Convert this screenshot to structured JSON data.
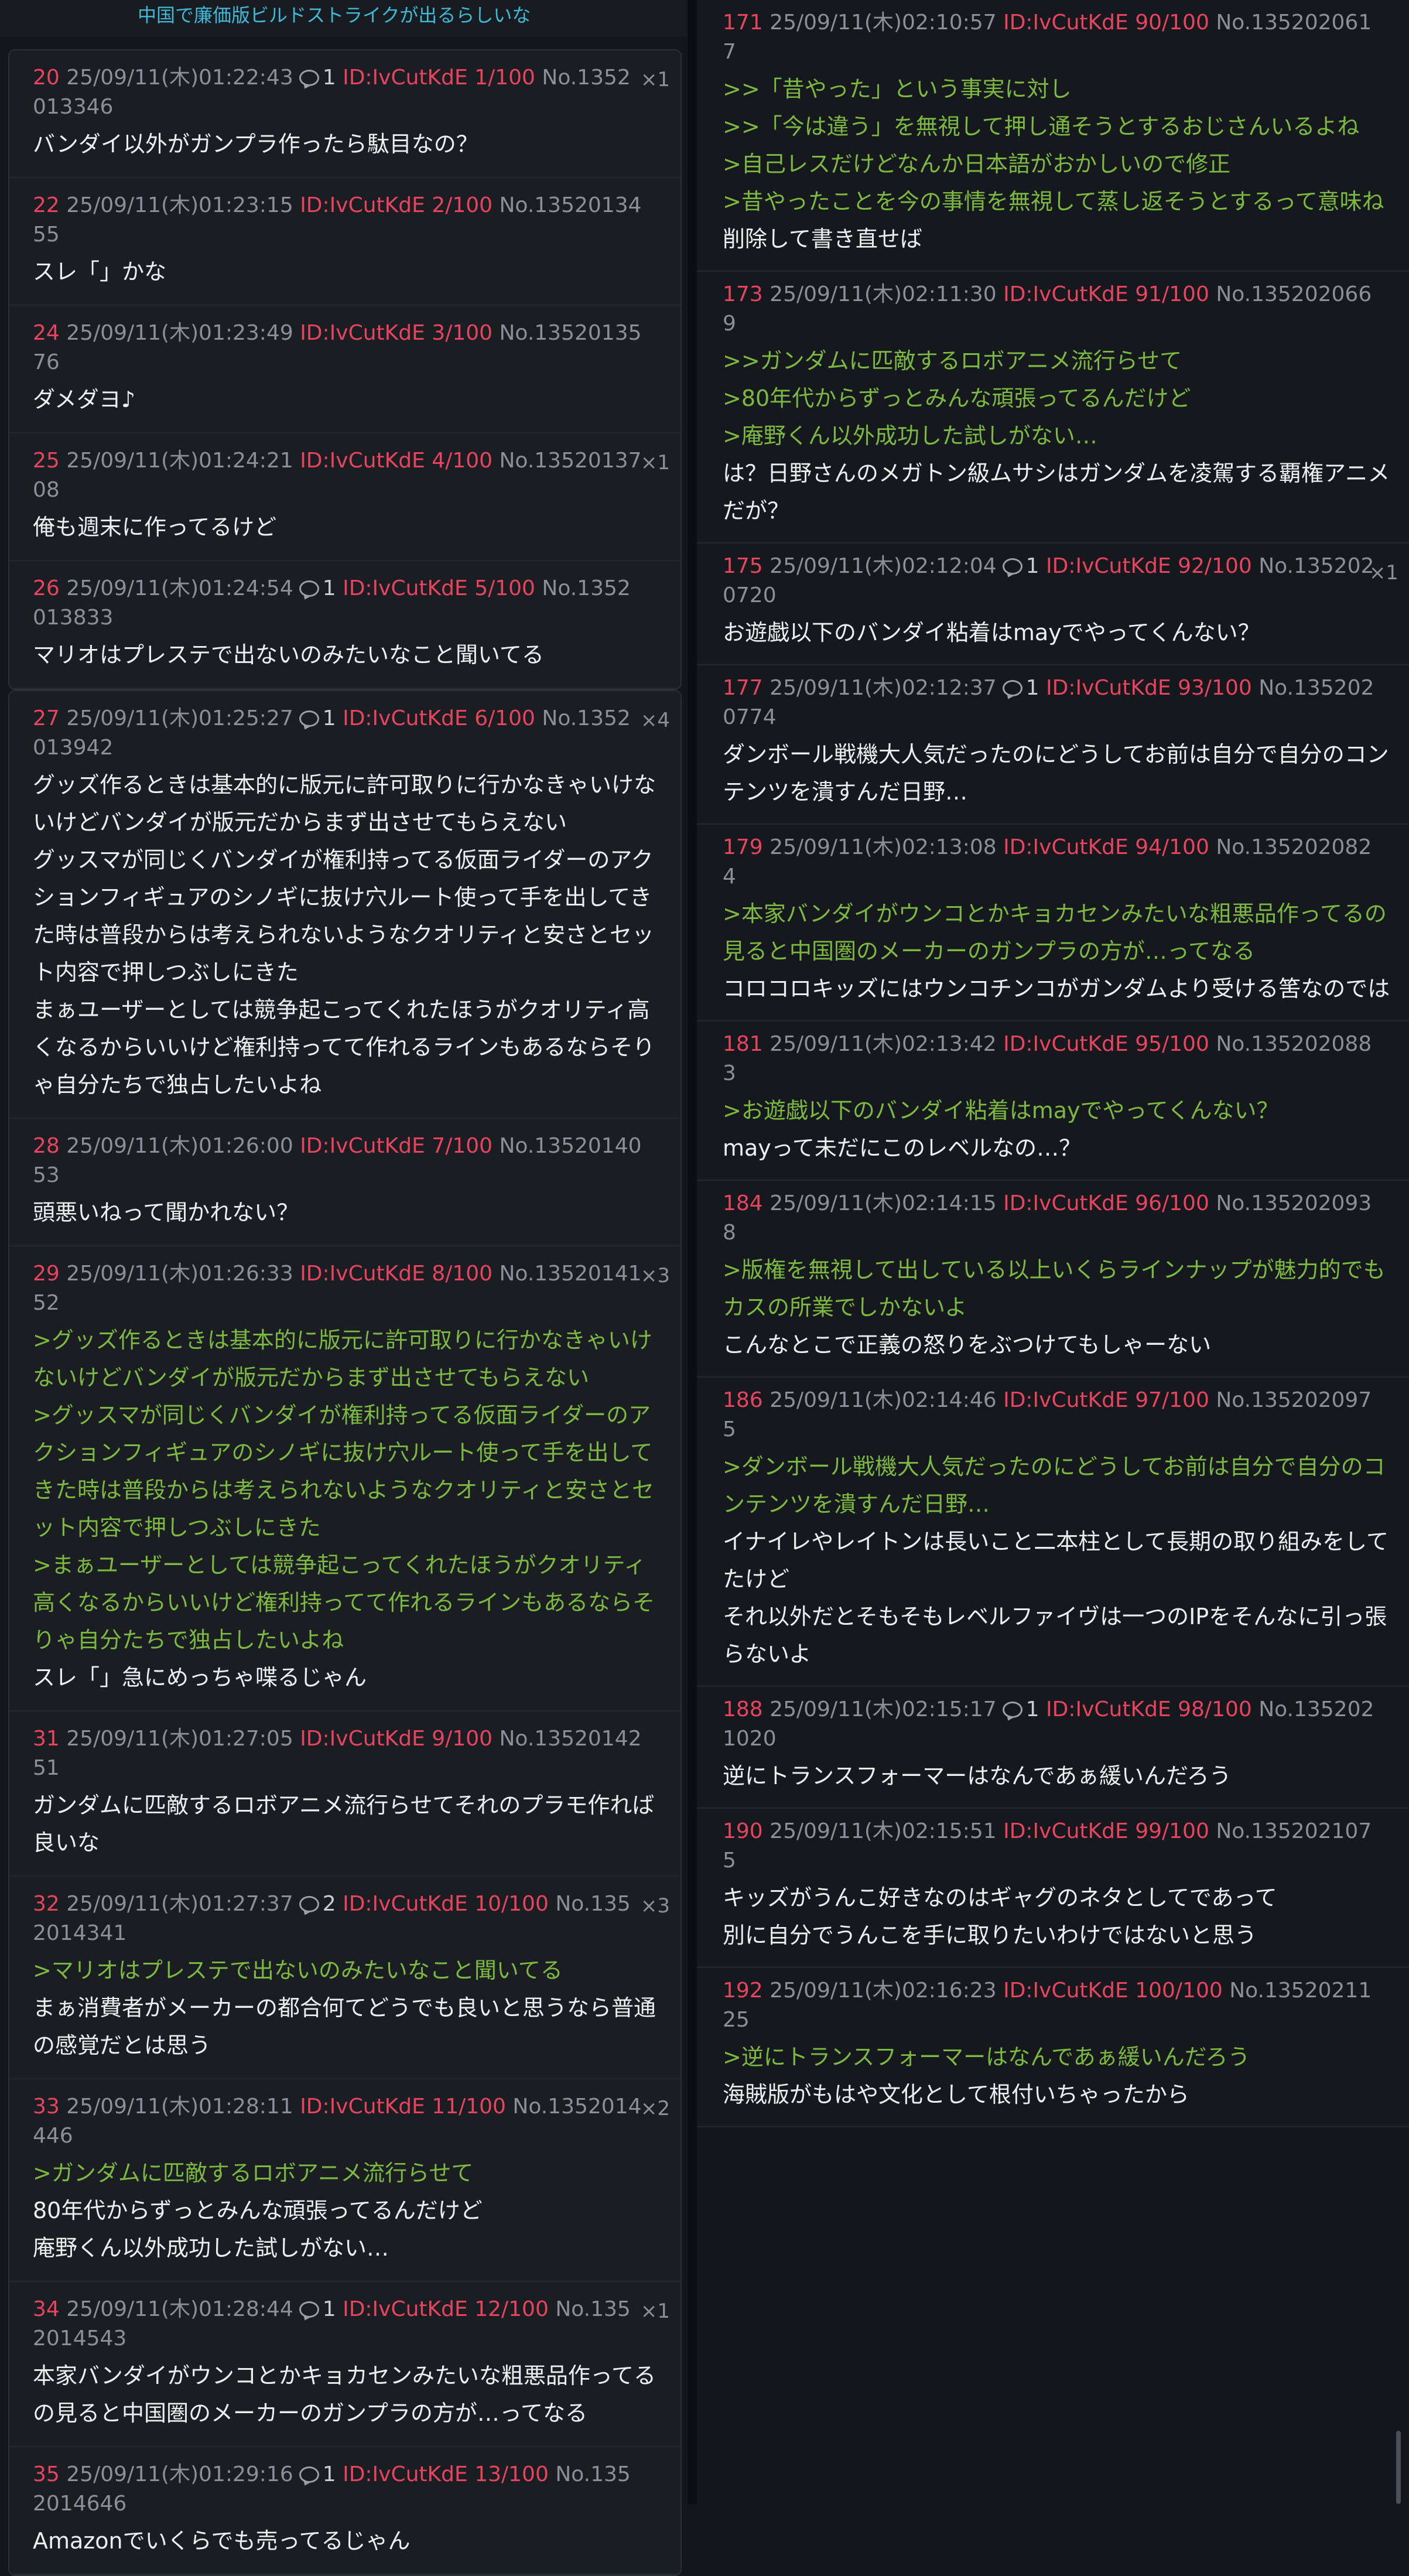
{
  "thread_title": "中国で廉価版ビルドストライクが出るらしいな",
  "left_posts": [
    {
      "num": "20",
      "date": "25/09/11(木)01:22:43",
      "replies": "1",
      "uid": "ID:IvCutKdE 1/100",
      "no": "No.1352013346",
      "x": "×1",
      "lines": [
        {
          "q": false,
          "t": "バンダイ以外がガンプラ作ったら駄目なの？"
        }
      ]
    },
    {
      "num": "22",
      "date": "25/09/11(木)01:23:15",
      "replies": "",
      "uid": "ID:IvCutKdE 2/100",
      "no": "No.1352013455",
      "x": "",
      "lines": [
        {
          "q": false,
          "t": "スレ「」かな"
        }
      ]
    },
    {
      "num": "24",
      "date": "25/09/11(木)01:23:49",
      "replies": "",
      "uid": "ID:IvCutKdE 3/100",
      "no": "No.1352013576",
      "x": "",
      "lines": [
        {
          "q": false,
          "t": "ダメダヨ♪"
        }
      ]
    },
    {
      "num": "25",
      "date": "25/09/11(木)01:24:21",
      "replies": "",
      "uid": "ID:IvCutKdE 4/100",
      "no": "No.1352013708",
      "x": "×1",
      "lines": [
        {
          "q": false,
          "t": "俺も週末に作ってるけど"
        }
      ]
    },
    {
      "num": "26",
      "date": "25/09/11(木)01:24:54",
      "replies": "1",
      "uid": "ID:IvCutKdE 5/100",
      "no": "No.1352013833",
      "x": "",
      "lines": [
        {
          "q": false,
          "t": "マリオはプレステで出ないのみたいなこと聞いてる"
        }
      ]
    },
    {
      "num": "27",
      "date": "25/09/11(木)01:25:27",
      "replies": "1",
      "uid": "ID:IvCutKdE 6/100",
      "no": "No.1352013942",
      "x": "×4",
      "lines": [
        {
          "q": false,
          "t": "グッズ作るときは基本的に版元に許可取りに行かなきゃいけないけどバンダイが版元だからまず出させてもらえない"
        },
        {
          "q": false,
          "t": "グッスマが同じくバンダイが権利持ってる仮面ライダーのアクションフィギュアのシノギに抜け穴ルート使って手を出してきた時は普段からは考えられないようなクオリティと安さとセット内容で押しつぶしにきた"
        },
        {
          "q": false,
          "t": "まぁユーザーとしては競争起こってくれたほうがクオリティ高くなるからいいけど権利持ってて作れるラインもあるならそりゃ自分たちで独占したいよね"
        }
      ]
    },
    {
      "num": "28",
      "date": "25/09/11(木)01:26:00",
      "replies": "",
      "uid": "ID:IvCutKdE 7/100",
      "no": "No.1352014053",
      "x": "",
      "lines": [
        {
          "q": false,
          "t": "頭悪いねって聞かれない？"
        }
      ]
    },
    {
      "num": "29",
      "date": "25/09/11(木)01:26:33",
      "replies": "",
      "uid": "ID:IvCutKdE 8/100",
      "no": "No.1352014152",
      "x": "×3",
      "lines": [
        {
          "q": true,
          "t": ">グッズ作るときは基本的に版元に許可取りに行かなきゃいけないけどバンダイが版元だからまず出させてもらえない"
        },
        {
          "q": true,
          "t": ">グッスマが同じくバンダイが権利持ってる仮面ライダーのアクションフィギュアのシノギに抜け穴ルート使って手を出してきた時は普段からは考えられないようなクオリティと安さとセット内容で押しつぶしにきた"
        },
        {
          "q": true,
          "t": ">まぁユーザーとしては競争起こってくれたほうがクオリティ高くなるからいいけど権利持ってて作れるラインもあるならそりゃ自分たちで独占したいよね"
        },
        {
          "q": false,
          "t": "スレ「」急にめっちゃ喋るじゃん"
        }
      ]
    },
    {
      "num": "31",
      "date": "25/09/11(木)01:27:05",
      "replies": "",
      "uid": "ID:IvCutKdE 9/100",
      "no": "No.1352014251",
      "x": "",
      "lines": [
        {
          "q": false,
          "t": "ガンダムに匹敵するロボアニメ流行らせてそれのプラモ作れば良いな"
        }
      ]
    },
    {
      "num": "32",
      "date": "25/09/11(木)01:27:37",
      "replies": "2",
      "uid": "ID:IvCutKdE 10/100",
      "no": "No.1352014341",
      "x": "×3",
      "lines": [
        {
          "q": true,
          "t": ">マリオはプレステで出ないのみたいなこと聞いてる"
        },
        {
          "q": false,
          "t": "まぁ消費者がメーカーの都合何てどうでも良いと思うなら普通の感覚だとは思う"
        }
      ]
    },
    {
      "num": "33",
      "date": "25/09/11(木)01:28:11",
      "replies": "",
      "uid": "ID:IvCutKdE 11/100",
      "no": "No.1352014446",
      "x": "×2",
      "lines": [
        {
          "q": true,
          "t": ">ガンダムに匹敵するロボアニメ流行らせて"
        },
        {
          "q": false,
          "t": "80年代からずっとみんな頑張ってるんだけど"
        },
        {
          "q": false,
          "t": "庵野くん以外成功した試しがない…"
        }
      ]
    },
    {
      "num": "34",
      "date": "25/09/11(木)01:28:44",
      "replies": "1",
      "uid": "ID:IvCutKdE 12/100",
      "no": "No.1352014543",
      "x": "×1",
      "lines": [
        {
          "q": false,
          "t": "本家バンダイがウンコとかキョカセンみたいな粗悪品作ってるの見ると中国圏のメーカーのガンプラの方が…ってなる"
        }
      ]
    },
    {
      "num": "35",
      "date": "25/09/11(木)01:29:16",
      "replies": "1",
      "uid": "ID:IvCutKdE 13/100",
      "no": "No.1352014646",
      "x": "",
      "lines": [
        {
          "q": false,
          "t": "Amazonでいくらでも売ってるじゃん"
        }
      ]
    }
  ],
  "right_posts": [
    {
      "num": "171",
      "date": "25/09/11(木)02:10:57",
      "replies": "",
      "uid": "ID:IvCutKdE 90/100",
      "no": "No.1352020617",
      "x": "",
      "lines": [
        {
          "q": true,
          "t": ">>「昔やった」という事実に対し"
        },
        {
          "q": true,
          "t": ">>「今は違う」を無視して押し通そうとするおじさんいるよね"
        },
        {
          "q": true,
          "t": ">自己レスだけどなんか日本語がおかしいので修正"
        },
        {
          "q": true,
          "t": ">昔やったことを今の事情を無視して蒸し返そうとするって意味ね"
        },
        {
          "q": false,
          "t": "削除して書き直せば"
        }
      ]
    },
    {
      "num": "173",
      "date": "25/09/11(木)02:11:30",
      "replies": "",
      "uid": "ID:IvCutKdE 91/100",
      "no": "No.1352020669",
      "x": "",
      "lines": [
        {
          "q": true,
          "t": ">>ガンダムに匹敵するロボアニメ流行らせて"
        },
        {
          "q": true,
          "t": ">80年代からずっとみんな頑張ってるんだけど"
        },
        {
          "q": true,
          "t": ">庵野くん以外成功した試しがない…"
        },
        {
          "q": false,
          "t": "は？日野さんのメガトン級ムサシはガンダムを凌駕する覇権アニメだが？"
        }
      ]
    },
    {
      "num": "175",
      "date": "25/09/11(木)02:12:04",
      "replies": "1",
      "uid": "ID:IvCutKdE 92/100",
      "no": "No.1352020720",
      "x": "×1",
      "lines": [
        {
          "q": false,
          "t": "お遊戯以下のバンダイ粘着はmayでやってくんない？"
        }
      ]
    },
    {
      "num": "177",
      "date": "25/09/11(木)02:12:37",
      "replies": "1",
      "uid": "ID:IvCutKdE 93/100",
      "no": "No.1352020774",
      "x": "",
      "lines": [
        {
          "q": false,
          "t": "ダンボール戦機大人気だったのにどうしてお前は自分で自分のコンテンツを潰すんだ日野…"
        }
      ]
    },
    {
      "num": "179",
      "date": "25/09/11(木)02:13:08",
      "replies": "",
      "uid": "ID:IvCutKdE 94/100",
      "no": "No.1352020824",
      "x": "",
      "lines": [
        {
          "q": true,
          "t": ">本家バンダイがウンコとかキョカセンみたいな粗悪品作ってるの見ると中国圏のメーカーのガンプラの方が…ってなる"
        },
        {
          "q": false,
          "t": "コロコロキッズにはウンコチンコがガンダムより受ける筈なのでは"
        }
      ]
    },
    {
      "num": "181",
      "date": "25/09/11(木)02:13:42",
      "replies": "",
      "uid": "ID:IvCutKdE 95/100",
      "no": "No.1352020883",
      "x": "",
      "lines": [
        {
          "q": true,
          "t": ">お遊戯以下のバンダイ粘着はmayでやってくんない？"
        },
        {
          "q": false,
          "t": "mayって未だにこのレベルなの…？"
        }
      ]
    },
    {
      "num": "184",
      "date": "25/09/11(木)02:14:15",
      "replies": "",
      "uid": "ID:IvCutKdE 96/100",
      "no": "No.1352020938",
      "x": "",
      "lines": [
        {
          "q": true,
          "t": ">版権を無視して出している以上いくらラインナップが魅力的でもカスの所業でしかないよ"
        },
        {
          "q": false,
          "t": "こんなとこで正義の怒りをぶつけてもしゃーない"
        }
      ]
    },
    {
      "num": "186",
      "date": "25/09/11(木)02:14:46",
      "replies": "",
      "uid": "ID:IvCutKdE 97/100",
      "no": "No.1352020975",
      "x": "",
      "lines": [
        {
          "q": true,
          "t": ">ダンボール戦機大人気だったのにどうしてお前は自分で自分のコンテンツを潰すんだ日野…"
        },
        {
          "q": false,
          "t": "イナイレやレイトンは長いこと二本柱として長期の取り組みをしてたけど"
        },
        {
          "q": false,
          "t": "それ以外だとそもそもレベルファイヴは一つのIPをそんなに引っ張らないよ"
        }
      ]
    },
    {
      "num": "188",
      "date": "25/09/11(木)02:15:17",
      "replies": "1",
      "uid": "ID:IvCutKdE 98/100",
      "no": "No.1352021020",
      "x": "",
      "lines": [
        {
          "q": false,
          "t": "逆にトランスフォーマーはなんであぁ緩いんだろう"
        }
      ]
    },
    {
      "num": "190",
      "date": "25/09/11(木)02:15:51",
      "replies": "",
      "uid": "ID:IvCutKdE 99/100",
      "no": "No.1352021075",
      "x": "",
      "lines": [
        {
          "q": false,
          "t": "キッズがうんこ好きなのはギャグのネタとしてであって"
        },
        {
          "q": false,
          "t": "別に自分でうんこを手に取りたいわけではないと思う"
        }
      ]
    },
    {
      "num": "192",
      "date": "25/09/11(木)02:16:23",
      "replies": "",
      "uid": "ID:IvCutKdE 100/100",
      "no": "No.1352021125",
      "x": "",
      "lines": [
        {
          "q": true,
          "t": ">逆にトランスフォーマーはなんであぁ緩いんだろう"
        },
        {
          "q": false,
          "t": "海賊版がもはや文化として根付いちゃったから"
        }
      ]
    }
  ]
}
